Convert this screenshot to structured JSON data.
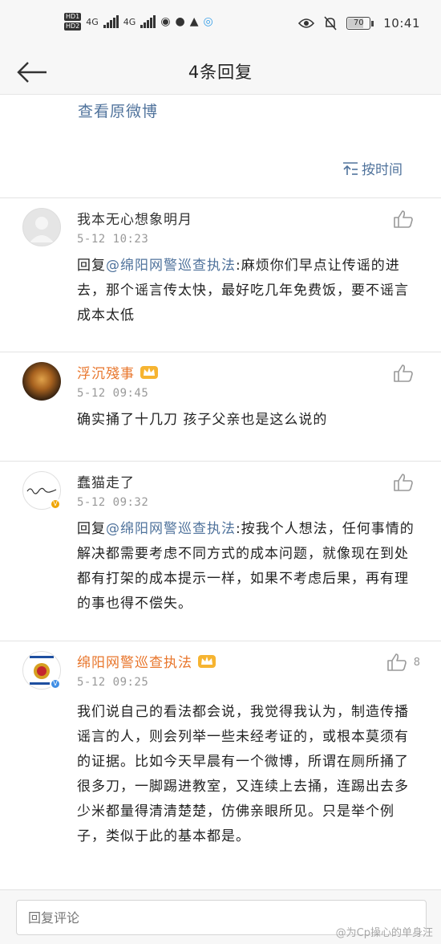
{
  "status_bar": {
    "hd1": "HD1",
    "hd2": "HD2",
    "net1": "4G",
    "net2": "4G",
    "battery": "70",
    "time": "10:41"
  },
  "header": {
    "title": "4条回复",
    "back_icon": "arrow-left-icon"
  },
  "original": {
    "view_label": "查看原微博",
    "sort_label": "按时间"
  },
  "comments": [
    {
      "name": "我本无心想象明月",
      "time": "5-12 10:23",
      "reply_prefix": "回复",
      "mention": "@绵阳网警巡查执法",
      "text": ":麻烦你们早点让传谣的进去，那个谣言传太快，最好吃几年免费饭，要不谣言成本太低",
      "likes": ""
    },
    {
      "name": "浮沉殘事",
      "time": "5-12 09:45",
      "text": "确实捅了十几刀 孩子父亲也是这么说的",
      "likes": ""
    },
    {
      "name": "蠢猫走了",
      "time": "5-12 09:32",
      "reply_prefix": "回复",
      "mention": "@绵阳网警巡查执法",
      "text": ":按我个人想法，任何事情的解决都需要考虑不同方式的成本问题，就像现在到处都有打架的成本提示一样，如果不考虑后果，再有理的事也得不偿失。",
      "likes": ""
    },
    {
      "name": "绵阳网警巡查执法",
      "time": "5-12 09:25",
      "text": "我们说自己的看法都会说，我觉得我认为，制造传播谣言的人，则会列举一些未经考证的，或根本莫须有的证据。比如今天早晨有一个微博，所谓在厕所捅了很多刀，一脚踢进教室，又连续上去捅，连踢出去多少米都量得清清楚楚，仿佛亲眼所见。只是举个例子，类似于此的基本都是。",
      "likes": "8"
    }
  ],
  "footer": {
    "placeholder": "回复评论",
    "watermark": "@为Cp操心的单身汪"
  },
  "colors": {
    "link": "#50739c",
    "vip_name": "#e8762c",
    "time": "#999999"
  }
}
